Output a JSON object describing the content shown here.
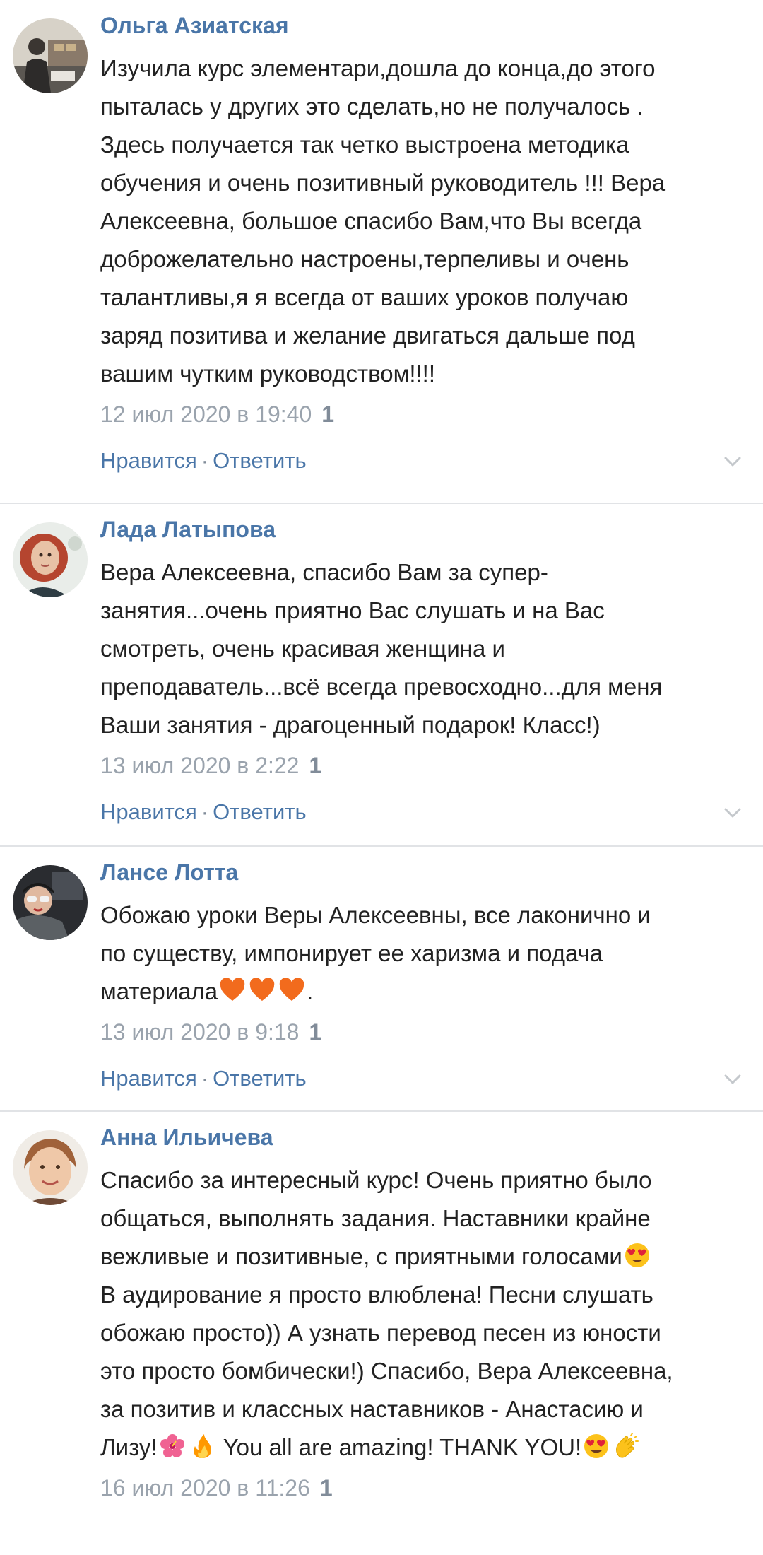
{
  "comments": [
    {
      "author": "Ольга Азиатская",
      "lines": [
        "Изучила курс элементари,дошла до конца,до этого",
        "пыталась у других это сделать,но не получалось .",
        "Здесь получается так четко выстроена методика",
        "обучения и очень позитивный руководитель !!! Вера",
        "Алексеевна, большое спасибо Вам,что Вы всегда",
        "доброжелательно настроены,терпеливы и очень",
        "талантливы,я я всегда от ваших уроков получаю",
        "заряд позитива и желание двигаться дальше под",
        "вашим чутким руководством!!!!"
      ],
      "date": "12 июл 2020 в 19:40",
      "likes": "1",
      "like_label": "Нравится",
      "reply_label": "Ответить",
      "avatar_icon": "avatar-photo-desk"
    },
    {
      "author": "Лада Латыпова",
      "lines": [
        "Вера Алексеевна, спасибо Вам за супер-",
        "занятия...очень приятно Вас слушать и на Вас",
        "смотреть, очень красивая женщина и",
        "преподаватель...всё всегда превосходно...для меня",
        "Ваши занятия - драгоценный подарок! Класс!)"
      ],
      "date": "13 июл 2020 в 2:22",
      "likes": "1",
      "like_label": "Нравится",
      "reply_label": "Ответить",
      "avatar_icon": "avatar-photo-woman-redhair"
    },
    {
      "author": "Лансе Лотта",
      "lines": [
        "Обожаю уроки Веры Алексеевны, все лаконично и",
        "по существу, импонирует ее харизма и подача"
      ],
      "last_line_text": "материала",
      "last_line_tail": ".",
      "last_line_emojis": [
        "orange-heart-icon",
        "orange-heart-icon",
        "orange-heart-icon"
      ],
      "date": "13 июл 2020 в 9:18",
      "likes": "1",
      "like_label": "Нравится",
      "reply_label": "Ответить",
      "avatar_icon": "avatar-photo-dark-sunglasses"
    },
    {
      "author": "Анна Ильичева",
      "lines": [
        "Спасибо за интересный курс! Очень приятно было",
        "общаться, выполнять задания. Наставники крайне"
      ],
      "line3_text": "вежливые и позитивные, с приятными голосами",
      "lines_after": [
        "В аудирование я просто влюблена! Песни слушать",
        "обожаю просто)) А узнать перевод песен из юности",
        "это просто бомбически!) Спасибо, Вера Алексеевна,",
        "за позитив и классных наставников - Анастасию и"
      ],
      "last_line_start": "Лизу!",
      "last_line_mid": " You all are amazing! THANK YOU!",
      "date": "16 июл 2020 в 11:26",
      "likes": "1",
      "avatar_icon": "avatar-photo-woman-smiling"
    }
  ],
  "colors": {
    "link": "#4a76a8",
    "meta": "#9aa3ad",
    "divider": "#e1e3e6",
    "text": "#222222"
  }
}
